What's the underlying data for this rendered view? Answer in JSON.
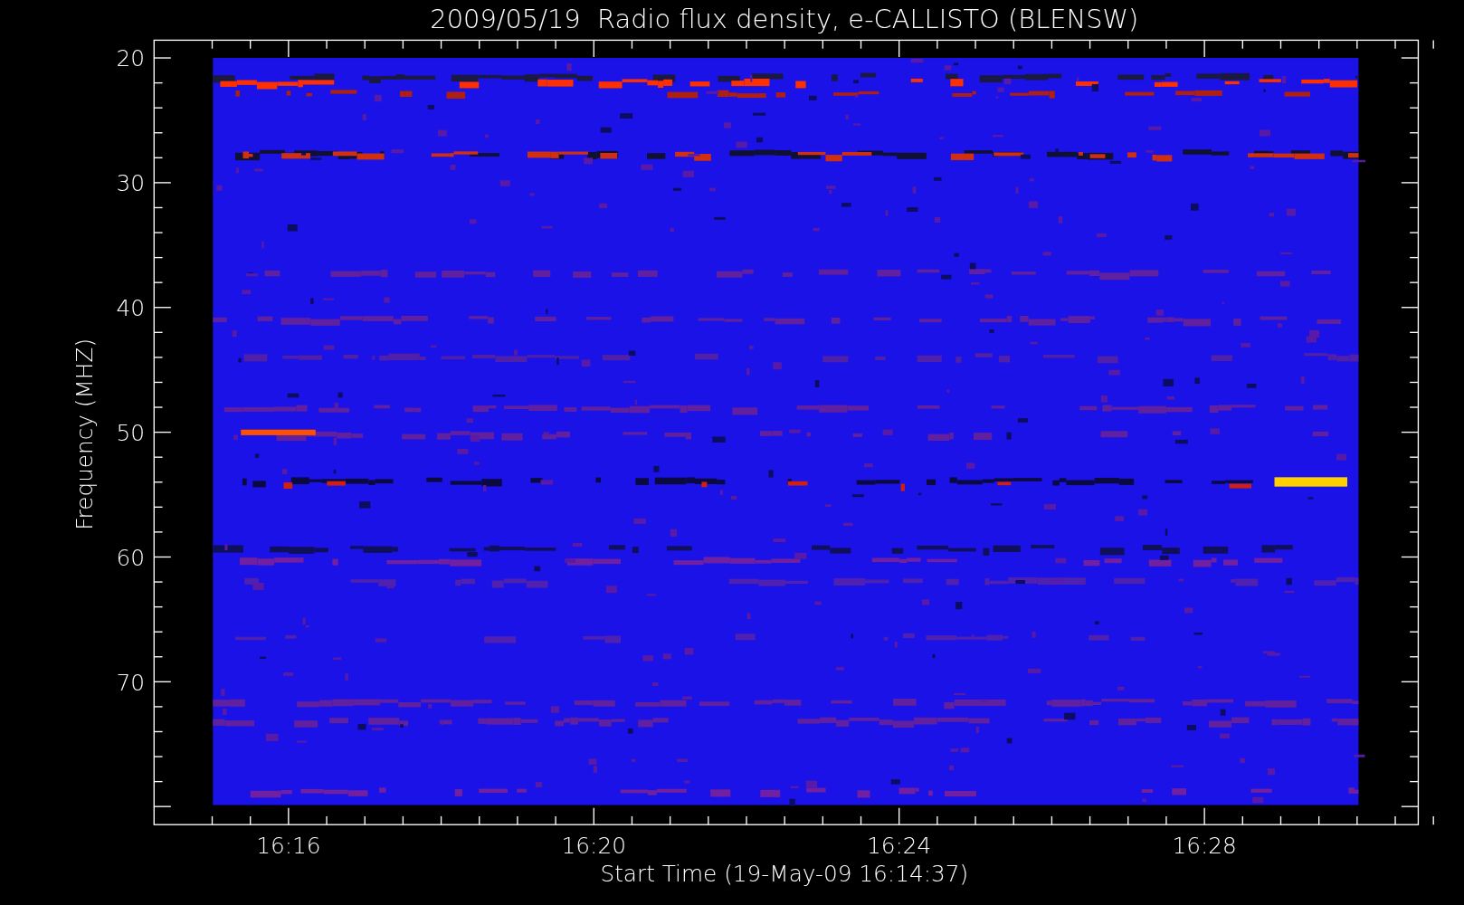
{
  "title": "2009/05/19  Radio flux density, e-CALLISTO (BLENSW)",
  "y_axis": {
    "label": "Frequency (MHZ)",
    "ticks": [
      "20",
      "30",
      "40",
      "50",
      "60",
      "70"
    ]
  },
  "x_axis": {
    "label": "Start Time (19-May-09 16:14:37)",
    "ticks": [
      "16:16",
      "16:20",
      "16:24",
      "16:28"
    ]
  }
}
